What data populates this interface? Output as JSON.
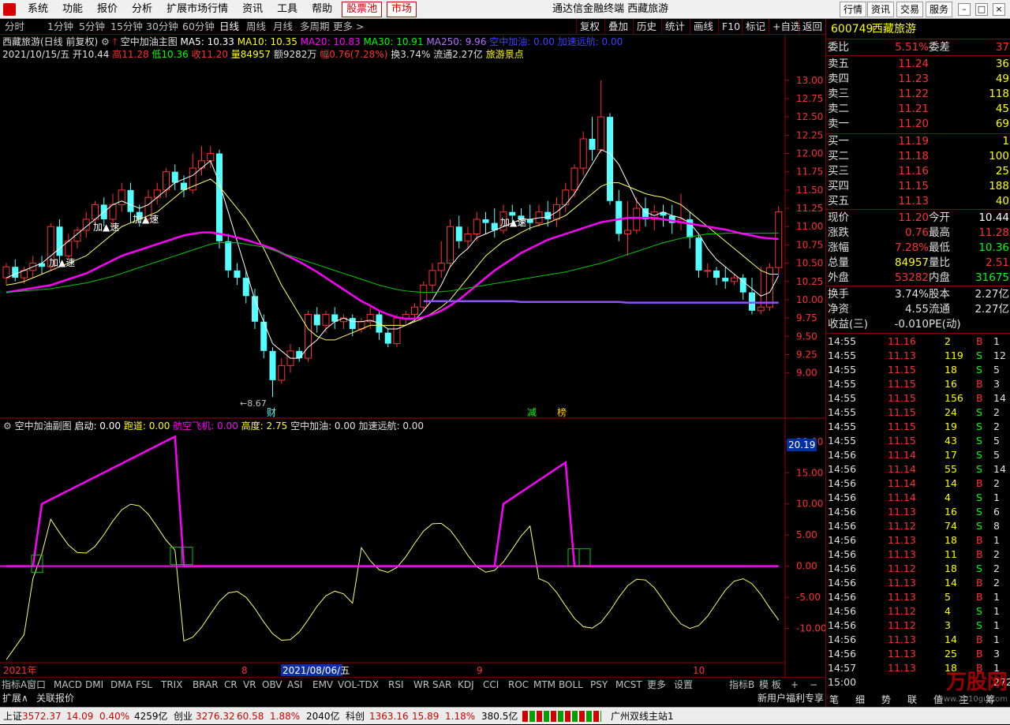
{
  "menubar": {
    "items": [
      "系统",
      "功能",
      "报价",
      "分析",
      "扩展市场行情",
      "资讯",
      "工具",
      "帮助"
    ],
    "stockpool": "股票池",
    "market": "市场",
    "title": "通达信金融终端  西藏旅游",
    "right_buttons": [
      "行情",
      "资讯",
      "交易",
      "服务"
    ]
  },
  "period": {
    "items": [
      "分时",
      "1分钟",
      "5分钟",
      "15分钟",
      "30分钟",
      "60分钟",
      "日线",
      "周线",
      "月线",
      "多周期",
      "更多 >"
    ],
    "active": "日线",
    "right": [
      "复权",
      "叠加",
      "历史",
      "统计",
      "画线",
      "F10",
      "标记",
      "+自选",
      "返回"
    ]
  },
  "main_info": {
    "name": "西藏旅游(日线 前复权)",
    "indicator": "空中加油主图",
    "ma5": "MA5: 10.33",
    "ma10": "MA10: 10.35",
    "ma20": "MA20: 10.83",
    "ma30": "MA30: 10.91",
    "ma250": "MA250: 9.96",
    "kz": "空中加油: 0.00",
    "js": "加速远航: 0.00"
  },
  "bar_info": {
    "date": "2021/10/15/五",
    "open": "开10.44",
    "high": "高11.28",
    "low": "低10.36",
    "close": "收11.20",
    "vol": "量84957",
    "amt": "额9282万",
    "chg": "幅0.76(7.28%)",
    "turn": "换3.74%",
    "float": "流通2.27亿",
    "sector": "旅游景点"
  },
  "sub_info": {
    "name": "空中加油副图",
    "qd": "启动: 0.00",
    "pd": "跑道: 0.00",
    "hk": "航空飞机: 0.00",
    "gd": "高度: 2.75",
    "kz": "空中加油: 0.00",
    "js": "加速远航: 0.00",
    "cur": "20.19"
  },
  "chart_data": {
    "type": "candlestick",
    "price_axis": {
      "ticks": [
        "13.00",
        "12.75",
        "12.50",
        "12.25",
        "12.00",
        "11.75",
        "11.50",
        "11.25",
        "11.00",
        "10.75",
        "10.50",
        "10.25",
        "10.00",
        "9.75",
        "9.50",
        "9.25",
        "9.00"
      ],
      "range": [
        8.5,
        13.3
      ]
    },
    "sub_axis": {
      "ticks": [
        "20.00",
        "15.00",
        "10.00",
        "5.00",
        "0.00",
        "-5.00",
        "-10.00"
      ],
      "range": [
        -16,
        22
      ]
    },
    "x_labels": [
      "2021年",
      "8",
      "2021/08/06/五",
      "9",
      "10"
    ],
    "min_label": "8.67",
    "markers": [
      "加▲速",
      "加▲速",
      "加▲速",
      "加▲速"
    ],
    "events": [
      "财",
      "减",
      "榜"
    ],
    "candles": [
      [
        10.3,
        10.45,
        10.2,
        10.5
      ],
      [
        10.45,
        10.3,
        10.25,
        10.55
      ],
      [
        10.3,
        10.4,
        10.22,
        10.45
      ],
      [
        10.4,
        10.5,
        10.3,
        10.6
      ],
      [
        10.5,
        10.45,
        10.35,
        10.6
      ],
      [
        10.45,
        11.0,
        10.4,
        11.05
      ],
      [
        11.0,
        10.6,
        10.5,
        11.1
      ],
      [
        10.6,
        10.8,
        10.55,
        10.9
      ],
      [
        10.8,
        10.95,
        10.7,
        11.0
      ],
      [
        10.95,
        11.1,
        10.85,
        11.2
      ],
      [
        11.1,
        11.3,
        11.0,
        11.35
      ],
      [
        11.3,
        11.1,
        11.0,
        11.4
      ],
      [
        11.1,
        11.3,
        11.0,
        11.45
      ],
      [
        11.3,
        11.5,
        11.2,
        11.6
      ],
      [
        11.5,
        11.2,
        11.05,
        11.6
      ],
      [
        11.2,
        11.1,
        11.0,
        11.3
      ],
      [
        11.1,
        11.4,
        11.05,
        11.5
      ],
      [
        11.4,
        11.5,
        11.3,
        11.6
      ],
      [
        11.5,
        11.75,
        11.4,
        11.8
      ],
      [
        11.75,
        11.6,
        11.5,
        11.85
      ],
      [
        11.6,
        11.5,
        11.4,
        11.7
      ],
      [
        11.5,
        11.8,
        11.45,
        12.0
      ],
      [
        11.8,
        11.9,
        11.7,
        12.1
      ],
      [
        11.9,
        12.0,
        11.8,
        12.1
      ],
      [
        12.0,
        10.8,
        10.7,
        12.05
      ],
      [
        10.8,
        10.4,
        10.3,
        10.9
      ],
      [
        10.4,
        10.3,
        10.2,
        10.5
      ],
      [
        10.3,
        10.05,
        9.95,
        10.4
      ],
      [
        10.05,
        9.7,
        9.6,
        10.15
      ],
      [
        9.7,
        9.3,
        9.2,
        9.8
      ],
      [
        9.3,
        8.9,
        8.67,
        9.35
      ],
      [
        8.9,
        9.1,
        8.85,
        9.2
      ],
      [
        9.1,
        9.3,
        9.0,
        9.4
      ],
      [
        9.3,
        9.2,
        9.15,
        9.35
      ],
      [
        9.2,
        9.8,
        9.15,
        9.85
      ],
      [
        9.8,
        9.65,
        9.55,
        9.9
      ],
      [
        9.65,
        9.8,
        9.55,
        9.85
      ],
      [
        9.8,
        9.7,
        9.6,
        9.9
      ],
      [
        9.7,
        9.75,
        9.6,
        9.8
      ],
      [
        9.75,
        9.6,
        9.5,
        9.8
      ],
      [
        9.6,
        9.7,
        9.55,
        9.75
      ],
      [
        9.7,
        9.8,
        9.6,
        9.9
      ],
      [
        9.8,
        9.55,
        9.45,
        9.85
      ],
      [
        9.55,
        9.4,
        9.35,
        9.6
      ],
      [
        9.4,
        9.75,
        9.35,
        9.8
      ],
      [
        9.75,
        9.8,
        9.65,
        9.85
      ],
      [
        9.8,
        9.9,
        9.7,
        9.95
      ],
      [
        9.9,
        10.2,
        9.85,
        10.25
      ],
      [
        10.2,
        10.4,
        10.1,
        10.5
      ],
      [
        10.4,
        10.5,
        10.3,
        10.8
      ],
      [
        10.5,
        11.0,
        10.45,
        11.1
      ],
      [
        11.0,
        10.8,
        10.7,
        11.15
      ],
      [
        10.8,
        10.9,
        10.7,
        11.0
      ],
      [
        10.9,
        11.1,
        10.8,
        11.2
      ],
      [
        11.1,
        11.05,
        10.9,
        11.2
      ],
      [
        11.05,
        10.95,
        10.85,
        11.25
      ],
      [
        10.95,
        11.2,
        10.9,
        11.3
      ],
      [
        11.2,
        11.15,
        11.05,
        11.3
      ],
      [
        11.15,
        11.1,
        11.0,
        11.25
      ],
      [
        11.1,
        11.05,
        10.95,
        11.3
      ],
      [
        11.05,
        11.2,
        11.0,
        11.3
      ],
      [
        11.2,
        11.1,
        11.0,
        11.35
      ],
      [
        11.1,
        11.3,
        11.0,
        11.4
      ],
      [
        11.3,
        11.5,
        11.2,
        11.6
      ],
      [
        11.5,
        11.8,
        11.4,
        11.85
      ],
      [
        11.8,
        12.2,
        11.7,
        12.3
      ],
      [
        12.2,
        12.05,
        11.9,
        12.5
      ],
      [
        12.05,
        12.5,
        12.0,
        13.0
      ],
      [
        12.5,
        11.35,
        11.3,
        12.55
      ],
      [
        11.35,
        10.9,
        10.8,
        11.5
      ],
      [
        10.9,
        10.95,
        10.6,
        11.35
      ],
      [
        10.95,
        11.25,
        10.9,
        11.4
      ],
      [
        11.25,
        11.1,
        11.0,
        11.4
      ],
      [
        11.1,
        11.2,
        10.95,
        11.3
      ],
      [
        11.2,
        11.15,
        11.0,
        11.3
      ],
      [
        11.15,
        11.05,
        10.9,
        11.3
      ],
      [
        11.05,
        11.1,
        10.95,
        11.45
      ],
      [
        11.1,
        10.85,
        10.7,
        11.2
      ],
      [
        10.85,
        10.4,
        10.3,
        10.9
      ],
      [
        10.4,
        10.4,
        10.3,
        10.5
      ],
      [
        10.4,
        10.3,
        10.2,
        10.45
      ],
      [
        10.3,
        10.25,
        10.15,
        10.45
      ],
      [
        10.25,
        10.3,
        10.2,
        10.35
      ],
      [
        10.3,
        10.1,
        10.0,
        10.35
      ],
      [
        10.1,
        9.85,
        9.8,
        10.3
      ],
      [
        9.85,
        9.9,
        9.8,
        10.45
      ],
      [
        9.9,
        10.44,
        9.85,
        10.5
      ],
      [
        10.44,
        11.2,
        10.36,
        11.28
      ]
    ],
    "ma5": [
      10.3,
      10.35,
      10.4,
      10.45,
      10.5,
      10.6,
      10.7,
      10.8,
      10.9,
      11.0,
      11.1,
      11.2,
      11.3,
      11.35,
      11.3,
      11.25,
      11.3,
      11.4,
      11.5,
      11.6,
      11.65,
      11.7,
      11.8,
      11.9,
      11.6,
      11.2,
      10.8,
      10.4,
      10.0,
      9.7,
      9.4,
      9.3,
      9.2,
      9.2,
      9.35,
      9.45,
      9.6,
      9.7,
      9.75,
      9.7,
      9.7,
      9.72,
      9.68,
      9.6,
      9.6,
      9.65,
      9.72,
      9.85,
      10.0,
      10.2,
      10.45,
      10.6,
      10.7,
      10.85,
      10.9,
      10.95,
      11.0,
      11.05,
      11.1,
      11.1,
      11.12,
      11.13,
      11.2,
      11.3,
      11.45,
      11.65,
      11.85,
      12.05,
      12.0,
      11.85,
      11.6,
      11.35,
      11.2,
      11.15,
      11.2,
      11.15,
      11.12,
      11.05,
      10.9,
      10.7,
      10.55,
      10.45,
      10.35,
      10.25,
      10.15,
      10.05,
      10.1,
      10.33
    ],
    "ma10": [
      10.2,
      10.22,
      10.25,
      10.3,
      10.35,
      10.4,
      10.45,
      10.5,
      10.55,
      10.6,
      10.7,
      10.8,
      10.9,
      11.0,
      11.05,
      11.1,
      11.15,
      11.2,
      11.3,
      11.4,
      11.5,
      11.55,
      11.6,
      11.65,
      11.55,
      11.4,
      11.25,
      11.1,
      10.9,
      10.7,
      10.45,
      10.2,
      10.0,
      9.8,
      9.6,
      9.5,
      9.45,
      9.45,
      9.5,
      9.55,
      9.6,
      9.65,
      9.65,
      9.65,
      9.65,
      9.65,
      9.7,
      9.75,
      9.82,
      9.9,
      10.0,
      10.15,
      10.3,
      10.45,
      10.6,
      10.7,
      10.8,
      10.85,
      10.92,
      10.98,
      11.02,
      11.05,
      11.1,
      11.15,
      11.25,
      11.35,
      11.45,
      11.55,
      11.6,
      11.6,
      11.55,
      11.5,
      11.45,
      11.42,
      11.4,
      11.35,
      11.3,
      11.2,
      11.1,
      11.0,
      10.9,
      10.8,
      10.7,
      10.6,
      10.5,
      10.4,
      10.35,
      10.35
    ],
    "ma20": [
      10.1,
      10.12,
      10.14,
      10.16,
      10.18,
      10.2,
      10.24,
      10.28,
      10.32,
      10.36,
      10.42,
      10.48,
      10.54,
      10.6,
      10.64,
      10.68,
      10.72,
      10.76,
      10.8,
      10.84,
      10.88,
      10.9,
      10.92,
      10.92,
      10.9,
      10.88,
      10.85,
      10.82,
      10.78,
      10.74,
      10.7,
      10.64,
      10.58,
      10.52,
      10.45,
      10.38,
      10.3,
      10.22,
      10.14,
      10.06,
      9.98,
      9.92,
      9.85,
      9.8,
      9.76,
      9.74,
      9.74,
      9.76,
      9.8,
      9.85,
      9.92,
      10.0,
      10.1,
      10.2,
      10.3,
      10.4,
      10.48,
      10.56,
      10.64,
      10.7,
      10.76,
      10.82,
      10.86,
      10.9,
      10.94,
      10.98,
      11.02,
      11.06,
      11.08,
      11.1,
      11.12,
      11.12,
      11.12,
      11.12,
      11.1,
      11.08,
      11.06,
      11.04,
      11.02,
      11.0,
      10.98,
      10.96,
      10.93,
      10.9,
      10.88,
      10.85,
      10.84,
      10.83
    ],
    "ma30": [
      10.1,
      10.11,
      10.12,
      10.13,
      10.14,
      10.15,
      10.17,
      10.19,
      10.21,
      10.23,
      10.26,
      10.29,
      10.32,
      10.36,
      10.4,
      10.44,
      10.48,
      10.52,
      10.56,
      10.6,
      10.64,
      10.68,
      10.72,
      10.76,
      10.78,
      10.78,
      10.78,
      10.76,
      10.74,
      10.72,
      10.68,
      10.64,
      10.6,
      10.56,
      10.52,
      10.48,
      10.44,
      10.4,
      10.36,
      10.32,
      10.28,
      10.24,
      10.2,
      10.17,
      10.14,
      10.12,
      10.11,
      10.1,
      10.1,
      10.11,
      10.12,
      10.14,
      10.16,
      10.18,
      10.2,
      10.22,
      10.24,
      10.26,
      10.28,
      10.3,
      10.32,
      10.34,
      10.36,
      10.38,
      10.41,
      10.44,
      10.47,
      10.5,
      10.54,
      10.58,
      10.62,
      10.66,
      10.7,
      10.74,
      10.78,
      10.81,
      10.84,
      10.86,
      10.88,
      10.9,
      10.9,
      10.91,
      10.91,
      10.91,
      10.91,
      10.91,
      10.91,
      10.91
    ],
    "ma250": [
      10.05,
      10.05,
      10.05,
      10.05,
      10.05,
      10.04,
      10.04,
      10.04,
      10.04,
      10.04,
      10.03,
      10.03,
      10.03,
      10.03,
      10.03,
      10.02,
      10.02,
      10.02,
      10.02,
      10.02,
      10.01,
      10.01,
      10.01,
      10.01,
      10.01,
      10.01,
      10.01,
      10.0,
      10.0,
      10.0,
      10.0,
      10.0,
      10.0,
      10.0,
      10.0,
      10.0,
      10.0,
      10.0,
      9.99,
      9.99,
      9.99,
      9.99,
      9.99,
      9.99,
      9.99,
      9.99,
      9.98,
      9.98,
      9.98,
      9.98,
      9.98,
      9.98,
      9.98,
      9.98,
      9.98,
      9.98,
      9.98,
      9.98,
      9.97,
      9.97,
      9.97,
      9.97,
      9.97,
      9.97,
      9.97,
      9.97,
      9.97,
      9.97,
      9.97,
      9.97,
      9.96,
      9.96,
      9.96,
      9.96,
      9.96,
      9.96,
      9.96,
      9.96,
      9.96,
      9.96,
      9.96,
      9.96,
      9.96,
      9.96,
      9.96,
      9.96,
      9.96,
      9.96
    ]
  },
  "bottom_tabs": [
    "指标A",
    "窗口",
    "MACD",
    "DMI",
    "DMA",
    "FSL",
    "TRIX",
    "BRAR",
    "CR",
    "VR",
    "OBV",
    "ASI",
    "EMV",
    "VOL-TDX",
    "RSI",
    "WR",
    "SAR",
    "KDJ",
    "CCI",
    "ROC",
    "MTM",
    "BOLL",
    "PSY",
    "MCST",
    "更多",
    "设置"
  ],
  "bottom_right": [
    "指标B",
    "模 板",
    "+",
    "−"
  ],
  "bottom2": [
    "扩展∧",
    "关联报价",
    "新用户福利专享"
  ],
  "status": {
    "sh_label": "上证",
    "sh": "3572.37",
    "sh_chg": "14.09",
    "sh_pct": "0.40%",
    "sh_amt": "4259亿",
    "cy_label": "创业",
    "cy": "3276.32",
    "cy_chg": "60.58",
    "cy_pct": "1.88%",
    "cy_amt": "2040亿",
    "kc_label": "科创",
    "kc": "1363.16",
    "kc_chg": "15.89",
    "kc_pct": "1.18%",
    "kc_amt": "380.5亿",
    "server": "广州双线主站1"
  },
  "quote": {
    "code": "600749",
    "name": "西藏旅游",
    "wb_label": "委比",
    "wb": "5.51%",
    "wc_label": "委差",
    "wc": "37",
    "asks": [
      {
        "l": "卖五",
        "p": "11.24",
        "v": "36"
      },
      {
        "l": "卖四",
        "p": "11.23",
        "v": "49"
      },
      {
        "l": "卖三",
        "p": "11.22",
        "v": "118"
      },
      {
        "l": "卖二",
        "p": "11.21",
        "v": "45"
      },
      {
        "l": "卖一",
        "p": "11.20",
        "v": "69"
      }
    ],
    "bids": [
      {
        "l": "买一",
        "p": "11.19",
        "v": "1"
      },
      {
        "l": "买二",
        "p": "11.18",
        "v": "100"
      },
      {
        "l": "买三",
        "p": "11.16",
        "v": "25"
      },
      {
        "l": "买四",
        "p": "11.15",
        "v": "188"
      },
      {
        "l": "买五",
        "p": "11.13",
        "v": "40"
      }
    ],
    "stats": [
      [
        "现价",
        "11.20",
        "今开",
        "10.44"
      ],
      [
        "涨跌",
        "0.76",
        "最高",
        "11.28"
      ],
      [
        "涨幅",
        "7.28%",
        "最低",
        "10.36"
      ],
      [
        "总量",
        "84957",
        "量比",
        "2.51"
      ],
      [
        "外盘",
        "53282",
        "内盘",
        "31675"
      ]
    ],
    "stats2": [
      [
        "换手",
        "3.74%",
        "股本",
        "2.27亿"
      ],
      [
        "净资",
        "4.55",
        "流通",
        "2.27亿"
      ],
      [
        "收益(三)",
        "-0.010",
        "PE(动)",
        ""
      ]
    ]
  },
  "ticks": [
    [
      "14:55",
      "11.16",
      "2",
      "B",
      "1"
    ],
    [
      "14:55",
      "11.13",
      "119",
      "S",
      "12"
    ],
    [
      "14:55",
      "11.15",
      "18",
      "S",
      "5"
    ],
    [
      "14:55",
      "11.15",
      "16",
      "B",
      "3"
    ],
    [
      "14:55",
      "11.15",
      "156",
      "B",
      "14"
    ],
    [
      "14:55",
      "11.15",
      "24",
      "S",
      "2"
    ],
    [
      "14:55",
      "11.15",
      "19",
      "S",
      "2"
    ],
    [
      "14:55",
      "11.15",
      "43",
      "S",
      "5"
    ],
    [
      "14:56",
      "11.14",
      "17",
      "S",
      "5"
    ],
    [
      "14:56",
      "11.14",
      "55",
      "S",
      "14"
    ],
    [
      "14:56",
      "11.14",
      "14",
      "B",
      "2"
    ],
    [
      "14:56",
      "11.14",
      "4",
      "S",
      "1"
    ],
    [
      "14:56",
      "11.13",
      "16",
      "S",
      "6"
    ],
    [
      "14:56",
      "11.12",
      "74",
      "S",
      "8"
    ],
    [
      "14:56",
      "11.13",
      "18",
      "B",
      "1"
    ],
    [
      "14:56",
      "11.13",
      "11",
      "B",
      "2"
    ],
    [
      "14:56",
      "11.12",
      "18",
      "S",
      "2"
    ],
    [
      "14:56",
      "11.13",
      "14",
      "B",
      "2"
    ],
    [
      "14:56",
      "11.13",
      "5",
      "B",
      "1"
    ],
    [
      "14:56",
      "11.12",
      "4",
      "S",
      "1"
    ],
    [
      "14:56",
      "11.12",
      "3",
      "S",
      "1"
    ],
    [
      "14:56",
      "11.13",
      "14",
      "B",
      "1"
    ],
    [
      "14:56",
      "11.13",
      "25",
      "B",
      "3"
    ],
    [
      "14:57",
      "11.13",
      "18",
      "B",
      "1"
    ],
    [
      "15:00",
      "",
      "",
      "",
      "272"
    ]
  ],
  "tick_side": [
    "笔",
    "细",
    "势",
    "联",
    "值",
    "主",
    "筹"
  ],
  "watermark": "万股网",
  "watermark_url": "www.2010gu.com"
}
